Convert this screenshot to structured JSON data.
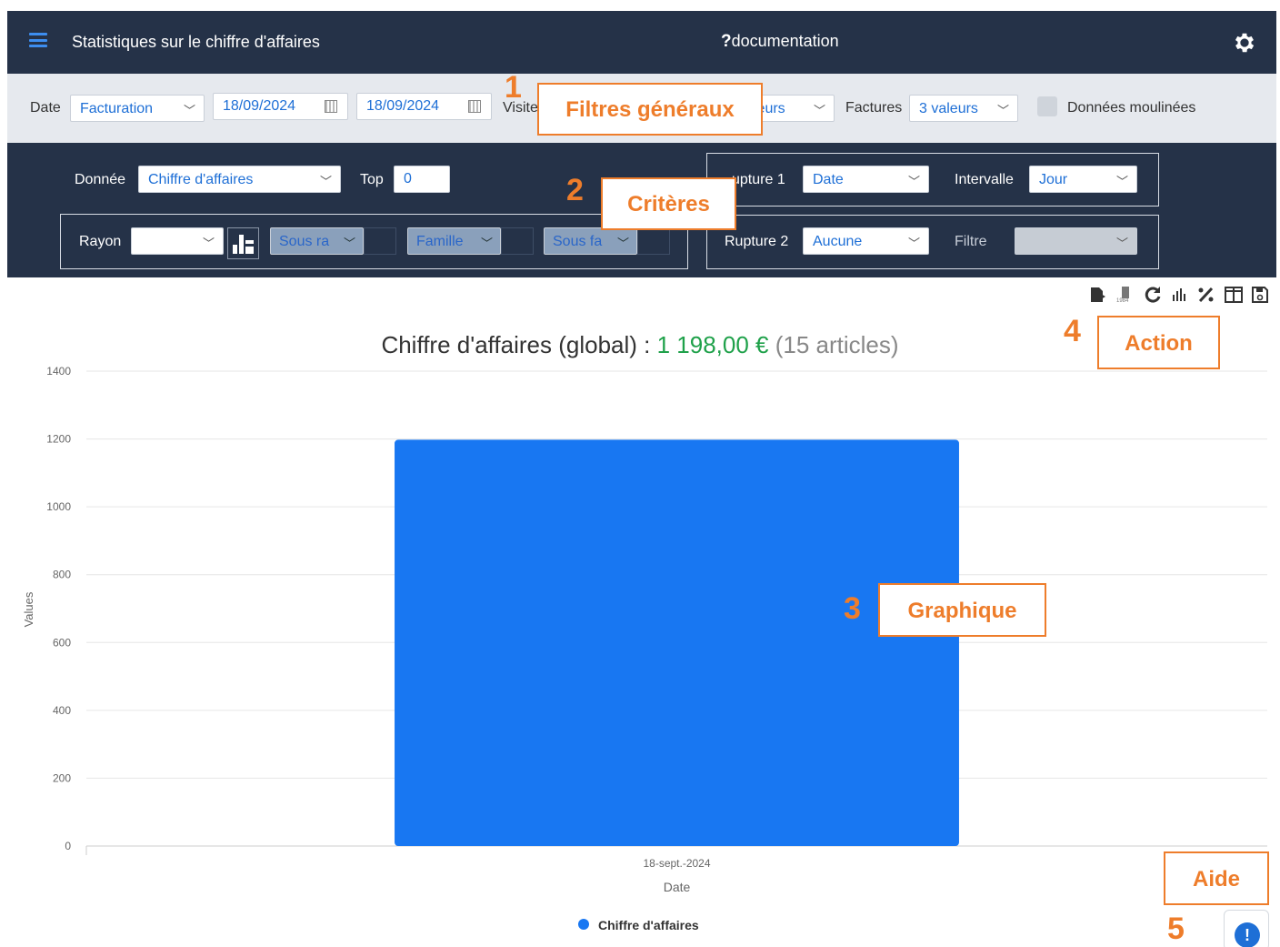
{
  "header": {
    "title": "Statistiques sur le chiffre d'affaires",
    "doc_q": "?",
    "doc_label": "documentation"
  },
  "filters": {
    "date_label": "Date",
    "date_type": "Facturation",
    "date_from": "18/09/2024",
    "date_to": "18/09/2024",
    "visite_label": "Visite",
    "visite_value": "leurs",
    "factures_label": "Factures",
    "factures_value": "3 valeurs",
    "moulinees_label": "Données moulinées"
  },
  "criteria": {
    "donnee_label": "Donnée",
    "donnee_value": "Chiffre d'affaires",
    "top_label": "Top",
    "top_value": "0",
    "rayon_label": "Rayon",
    "rayon_value": "",
    "sous_rayon": "Sous ra",
    "famille": "Famille",
    "sous_famille": "Sous fa",
    "rupture1_label": "upture 1",
    "rupture1_value": "Date",
    "intervalle_label": "Intervalle",
    "intervalle_value": "Jour",
    "rupture2_label": "Rupture 2",
    "rupture2_value": "Aucune",
    "filtre_label": "Filtre",
    "filtre_value": ""
  },
  "annotations": {
    "n1": "1",
    "t1": "Filtres généraux",
    "n2": "2",
    "t2": "Critères",
    "n3": "3",
    "t3": "Graphique",
    "n4": "4",
    "t4": "Action",
    "n5": "5",
    "t5": "Aide"
  },
  "toolbar": [
    "export-icon",
    "csv-export-icon",
    "refresh-icon",
    "bar-chart-icon",
    "percent-icon",
    "columns-icon",
    "save-icon"
  ],
  "chart_title": {
    "prefix": "Chiffre d'affaires (global) : ",
    "amount": "1 198,00 €",
    "count": "(15 articles)"
  },
  "help": {
    "glyph": "!"
  },
  "colors": {
    "header": "#253248",
    "accent": "#1e6fd6",
    "bar": "#1877f2",
    "annotation": "#ee7d2b",
    "green": "#1fa14a"
  },
  "chart_data": {
    "type": "bar",
    "categories": [
      "18-sept.-2024"
    ],
    "series": [
      {
        "name": "Chiffre d'affaires",
        "values": [
          1198
        ]
      }
    ],
    "xlabel": "Date",
    "ylabel": "Values",
    "ylim": [
      0,
      1400
    ],
    "yticks": [
      0,
      200,
      400,
      600,
      800,
      1000,
      1200,
      1400
    ],
    "grid": true,
    "legend": "bottom"
  }
}
